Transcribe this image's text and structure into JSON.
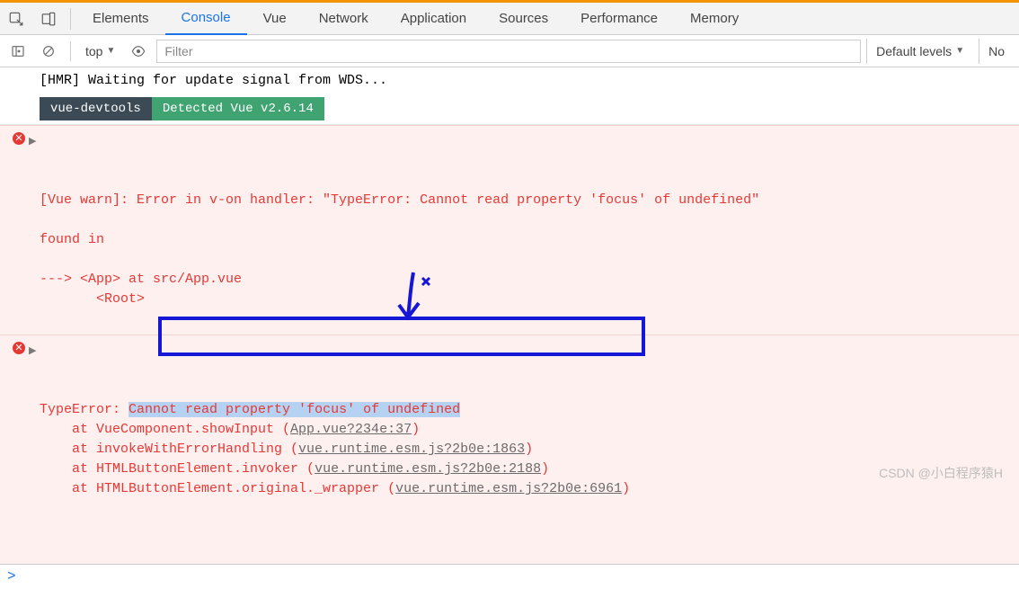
{
  "tabs": {
    "elements": "Elements",
    "console": "Console",
    "vue": "Vue",
    "network": "Network",
    "application": "Application",
    "sources": "Sources",
    "performance": "Performance",
    "memory": "Memory"
  },
  "toolbar": {
    "context": "top",
    "filter_placeholder": "Filter",
    "levels": "Default levels",
    "nohide": "No"
  },
  "log": {
    "hmr": "[HMR] Waiting for update signal from WDS...",
    "badge_devtools": "vue-devtools",
    "badge_detected": "Detected Vue v2.6.14"
  },
  "error1": {
    "head": "[Vue warn]: Error in v-on handler: \"TypeError: Cannot read property 'focus' of undefined\"",
    "found": "found in",
    "app": "---> <App> at src/App.vue",
    "root": "       <Root>"
  },
  "error2": {
    "head_a": "TypeError: ",
    "head_b": "Cannot read property 'focus' of undefined",
    "s1a": "    at VueComponent.showInput (",
    "s1b": "App.vue?234e:37",
    "s1c": ")",
    "s2a": "    at invokeWithErrorHandling (",
    "s2b": "vue.runtime.esm.js?2b0e:1863",
    "s2c": ")",
    "s3a": "    at HTMLButtonElement.invoker (",
    "s3b": "vue.runtime.esm.js?2b0e:2188",
    "s3c": ")",
    "s4a": "    at HTMLButtonElement.original._wrapper (",
    "s4b": "vue.runtime.esm.js?2b0e:6961",
    "s4c": ")"
  },
  "watermark": "CSDN @小白程序猿H"
}
